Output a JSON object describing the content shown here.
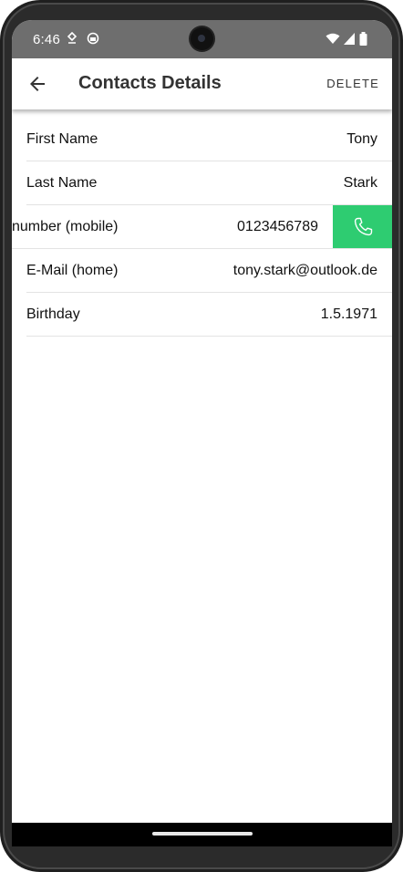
{
  "status_bar": {
    "time": "6:46"
  },
  "app_bar": {
    "title": "Contacts Details",
    "delete_label": "DELETE"
  },
  "fields": [
    {
      "label": "First Name",
      "value": "Tony"
    },
    {
      "label": "Last Name",
      "value": "Stark"
    },
    {
      "label": "number (mobile)",
      "value": "0123456789"
    },
    {
      "label": "E-Mail (home)",
      "value": "tony.stark@outlook.de"
    },
    {
      "label": "Birthday",
      "value": "1.5.1971"
    }
  ],
  "colors": {
    "call_button": "#2ecc71",
    "status_bar": "#6e6e6e"
  },
  "icons": {
    "back": "arrow-back-icon",
    "call": "phone-icon"
  }
}
